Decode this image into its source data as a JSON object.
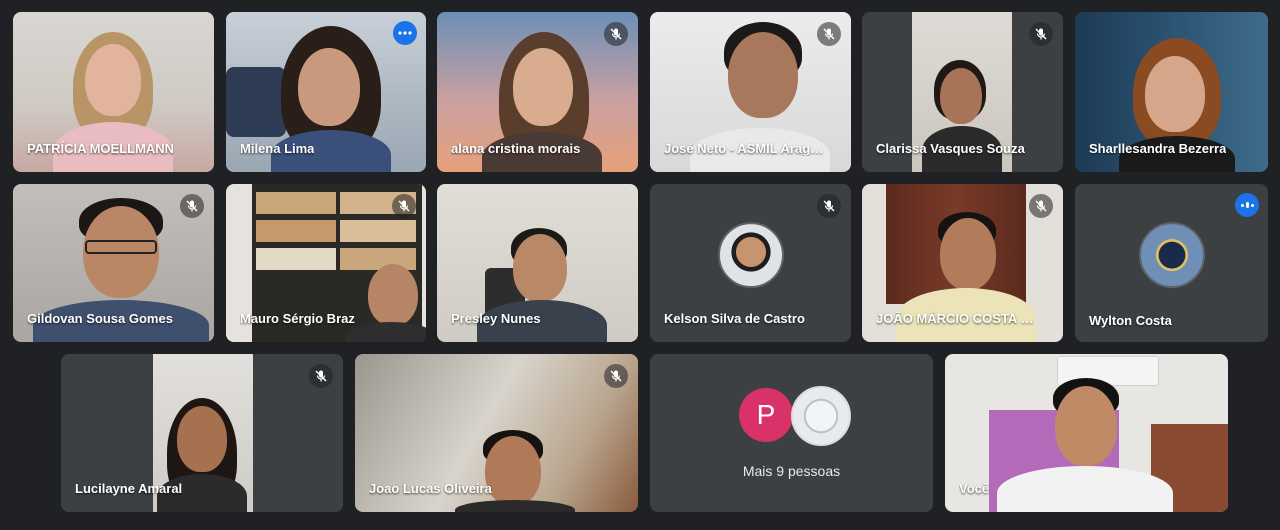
{
  "participants": [
    {
      "name": "PATRÍCIA MOELLMANN",
      "muted": false
    },
    {
      "name": "Milena Lima",
      "muted": false,
      "active_speaker": true
    },
    {
      "name": "alana cristina morais",
      "muted": true
    },
    {
      "name": "José Neto - ASMIL Aragu...",
      "muted": true
    },
    {
      "name": "Clarissa Vasques Souza",
      "muted": true
    },
    {
      "name": "Sharllesandra Bezerra",
      "muted": false
    },
    {
      "name": "Gildovan Sousa Gomes",
      "muted": true
    },
    {
      "name": "Mauro Sérgio Braz",
      "muted": true
    },
    {
      "name": "Presley Nunes",
      "muted": false
    },
    {
      "name": "Kelson Silva de Castro",
      "muted": true,
      "camera_off": true
    },
    {
      "name": "JOÃO MÁRCIO COSTA M...",
      "muted": true
    },
    {
      "name": "Wylton Costa",
      "muted": false,
      "camera_off": true
    },
    {
      "name": "Lucilayne Amaral",
      "muted": true
    },
    {
      "name": "Joao Lucas Oliveira",
      "muted": true
    },
    {
      "name": "Você",
      "muted": false
    }
  ],
  "more_tile": {
    "label": "Mais 9 pessoas",
    "initial": "P"
  },
  "icons": {
    "mic_off": "mic-off-icon",
    "more": "more-options-icon",
    "speaking": "speaking-indicator-icon"
  },
  "colors": {
    "background": "#202124",
    "tile": "#3c4043",
    "accent": "#1a73e8",
    "avatar_p": "#d93268"
  }
}
